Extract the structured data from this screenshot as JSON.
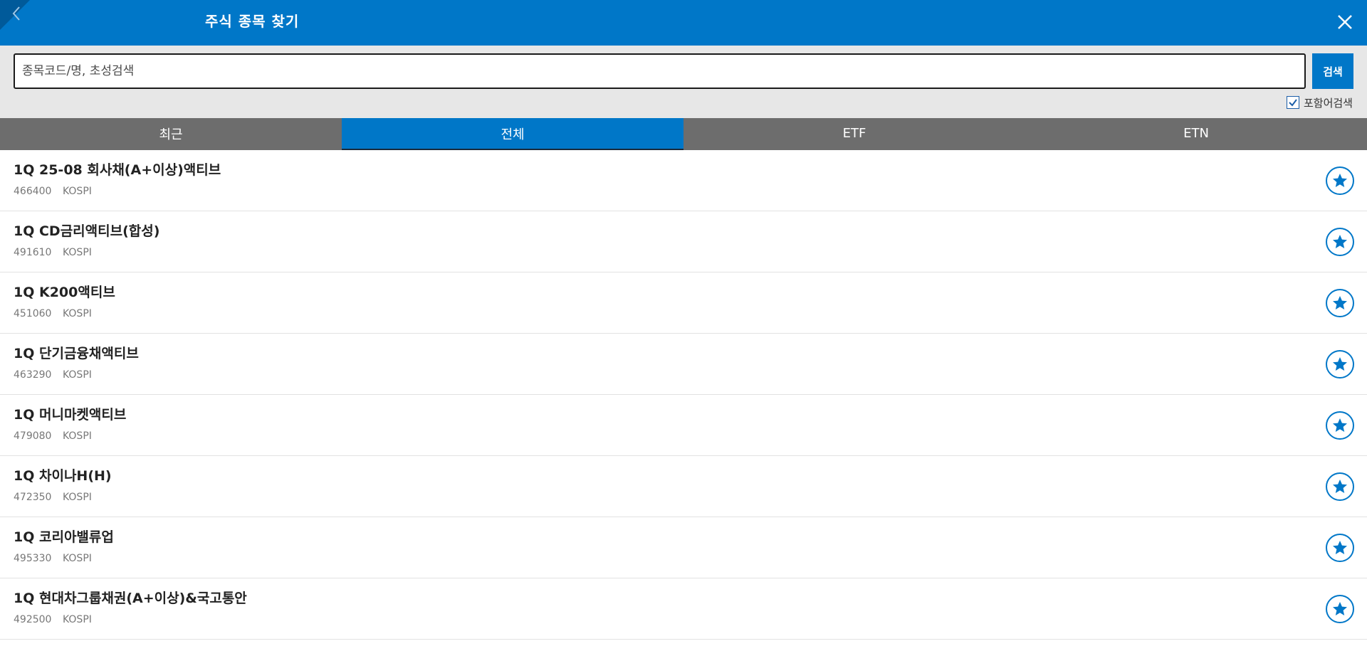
{
  "header": {
    "title": "주식 종목 찾기",
    "back_icon": "chevron-left-icon",
    "close_icon": "close-icon"
  },
  "search": {
    "placeholder": "종목코드/명, 초성검색",
    "value": "",
    "button_label": "검색",
    "include_label": "포함어검색",
    "include_checked": true
  },
  "tabs": [
    {
      "label": "최근",
      "active": false
    },
    {
      "label": "전체",
      "active": true
    },
    {
      "label": "ETF",
      "active": false
    },
    {
      "label": "ETN",
      "active": false
    }
  ],
  "stocks": [
    {
      "name": "1Q 25-08 회사채(A+이상)액티브",
      "code": "466400",
      "market": "KOSPI"
    },
    {
      "name": "1Q CD금리액티브(합성)",
      "code": "491610",
      "market": "KOSPI"
    },
    {
      "name": "1Q K200액티브",
      "code": "451060",
      "market": "KOSPI"
    },
    {
      "name": "1Q 단기금융채액티브",
      "code": "463290",
      "market": "KOSPI"
    },
    {
      "name": "1Q 머니마켓액티브",
      "code": "479080",
      "market": "KOSPI"
    },
    {
      "name": "1Q 차이나H(H)",
      "code": "472350",
      "market": "KOSPI"
    },
    {
      "name": "1Q 코리아밸류업",
      "code": "495330",
      "market": "KOSPI"
    },
    {
      "name": "1Q 현대차그룹채권(A+이상)&국고통안",
      "code": "492500",
      "market": "KOSPI"
    }
  ],
  "colors": {
    "primary": "#0077c8",
    "tab_bar": "#6d6d6d",
    "search_bg": "#e7e7e7"
  }
}
